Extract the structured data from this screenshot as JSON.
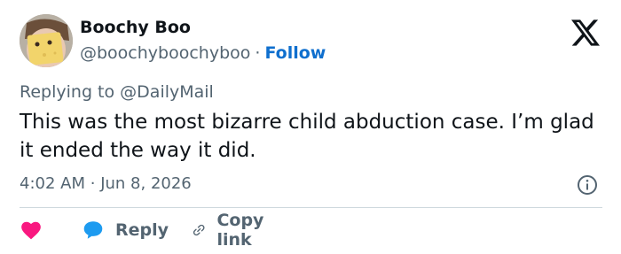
{
  "author": {
    "name": "Boochy Boo",
    "handle": "@boochyboochyboo",
    "separator": "·",
    "follow_label": "Follow"
  },
  "reply_context": {
    "prefix": "Replying to",
    "mention": "@DailyMail"
  },
  "tweet": {
    "text": "This was the most bizarre child abduction case. I’m glad it ended the way it did.",
    "time": "4:02 AM",
    "separator": "·",
    "date": "Jun 8, 2026"
  },
  "actions": {
    "reply_label": "Reply",
    "copy_link_label": "Copy link"
  },
  "icons": {
    "brand": "x-logo-icon",
    "info": "info-icon",
    "like": "heart-icon",
    "reply": "speech-bubble-icon",
    "copy": "link-icon"
  },
  "colors": {
    "heart": "#f91880",
    "reply_bubble": "#1d9bf0",
    "follow": "#0f6fce",
    "secondary_text": "#536471"
  }
}
